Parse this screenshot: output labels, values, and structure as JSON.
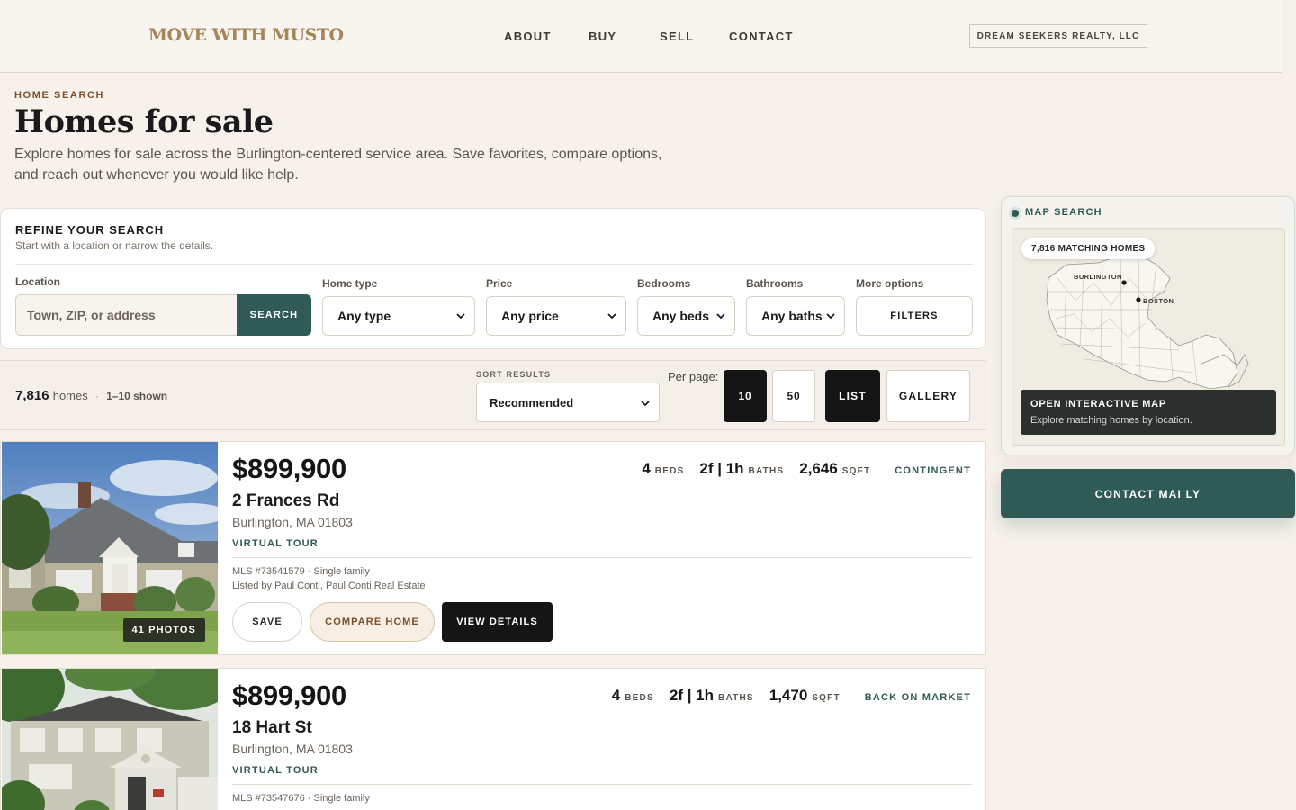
{
  "header": {
    "logo": "MOVE WITH MUSTO",
    "nav": [
      {
        "label": "ABOUT"
      },
      {
        "label": "BUY"
      },
      {
        "label": "SELL"
      },
      {
        "label": "CONTACT"
      }
    ],
    "brokerage": "DREAM SEEKERS REALTY, LLC"
  },
  "hero": {
    "eyebrow": "HOME SEARCH",
    "title": "Homes for sale",
    "intro": "Explore homes for sale across the Burlington-centered service area. Save favorites, compare options, and reach out whenever you would like help."
  },
  "refine": {
    "title": "REFINE YOUR SEARCH",
    "subtitle": "Start with a location or narrow the details.",
    "location_label": "Location",
    "location_placeholder": "Town, ZIP, or address",
    "search_label": "SEARCH",
    "home_type_label": "Home type",
    "home_type_value": "Any type",
    "price_label": "Price",
    "price_value": "Any price",
    "bedrooms_label": "Bedrooms",
    "bedrooms_value": "Any beds",
    "bathrooms_label": "Bathrooms",
    "bathrooms_value": "Any baths",
    "more_label": "More options",
    "filters_label": "FILTERS"
  },
  "results": {
    "count": "7,816",
    "count_unit": "homes",
    "separator": "·",
    "shown": "1–10 shown",
    "sort_label": "SORT RESULTS",
    "sort_value": "Recommended",
    "per_page_label": "Per page:",
    "per_page_options": [
      "10",
      "50"
    ],
    "per_page_selected": "10",
    "view_list": "LIST",
    "view_gallery": "GALLERY",
    "view_selected": "LIST"
  },
  "listings": [
    {
      "price": "$899,900",
      "address": "2 Frances Rd",
      "city": "Burlington, MA 01803",
      "tour": "VIRTUAL TOUR",
      "beds": "4",
      "beds_unit": "BEDS",
      "baths": "2f | 1h",
      "baths_unit": "BATHS",
      "sqft": "2,646",
      "sqft_unit": "SQFT",
      "status": "CONTINGENT",
      "mls": "MLS #73541579 · Single family",
      "agent": "Listed by Paul Conti, Paul Conti Real Estate",
      "photos": "41 PHOTOS",
      "save": "SAVE",
      "compare": "COMPARE HOME",
      "view": "VIEW DETAILS"
    },
    {
      "price": "$899,900",
      "address": "18 Hart St",
      "city": "Burlington, MA 01803",
      "tour": "VIRTUAL TOUR",
      "beds": "4",
      "beds_unit": "BEDS",
      "baths": "2f | 1h",
      "baths_unit": "BATHS",
      "sqft": "1,470",
      "sqft_unit": "SQFT",
      "status": "BACK ON MARKET",
      "mls": "MLS #73547676 · Single family"
    }
  ],
  "map": {
    "label": "MAP SEARCH",
    "matches": "7,816 MATCHING HOMES",
    "city_burlington": "BURLINGTON",
    "city_boston": "BOSTON",
    "overlay_title": "OPEN INTERACTIVE MAP",
    "overlay_sub": "Explore matching homes by location."
  },
  "contact": {
    "label": "CONTACT MAI LY"
  },
  "colors": {
    "accent": "#2f5a55",
    "logo": "#a5865a",
    "background": "#f6f1ea",
    "dark": "#151515"
  }
}
